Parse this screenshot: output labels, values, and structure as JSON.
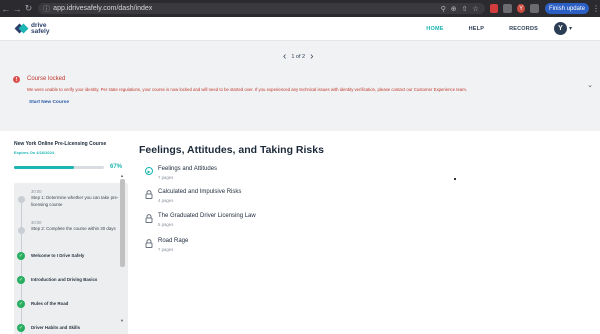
{
  "browser": {
    "url": "app.idrivesafely.com/dash/index",
    "profile_initial": "Y",
    "update_label": "Finish update"
  },
  "header": {
    "logo_line1": "drive",
    "logo_line2": "safely",
    "nav": {
      "home": "HOME",
      "help": "HELP",
      "records": "RECORDS"
    },
    "user_initial": "Y"
  },
  "pager": {
    "label": "1 of 2"
  },
  "alert": {
    "title": "Course locked",
    "message": "We were unable to verify your identity. Per state regulations, your course is now locked and will need to be started over. If you experienced any technical issues with identity verification, please contact our Customer Experience team.",
    "link": "Start New Course"
  },
  "sidebar": {
    "course_name": "New York Online Pre-Licensing Course",
    "expires": "Expires On 4/16/2024",
    "progress_value": 67,
    "progress_label": "67%",
    "steps": [
      {
        "time": "30:00",
        "text": "Step 1: Determine whether you can take pre-licensing course",
        "status": "pending"
      },
      {
        "time": "30:00",
        "text": "Step 2: Complete the course within 30 days",
        "status": "pending"
      },
      {
        "text": "Welcome to I Drive Safely",
        "status": "complete"
      },
      {
        "text": "Introduction and Driving Basics",
        "status": "complete"
      },
      {
        "text": "Rules of the Road",
        "status": "complete"
      },
      {
        "text": "Driver Habits and Skills",
        "status": "complete"
      }
    ]
  },
  "main": {
    "section_title": "Feelings, Attitudes, and Taking Risks",
    "modules": [
      {
        "title": "Feelings and Attitudes",
        "pages": "7 pages",
        "icon": "play-icon"
      },
      {
        "title": "Calculated and Impulsive Risks",
        "pages": "4 pages",
        "icon": "lock-icon"
      },
      {
        "title": "The Graduated Driver Licensing Law",
        "pages": "5 pages",
        "icon": "lock-icon"
      },
      {
        "title": "Road Rage",
        "pages": "7 pages",
        "icon": "lock-icon"
      }
    ]
  },
  "colors": {
    "accent": "#1bb5b3",
    "brand_navy": "#2c3e6b",
    "alert_red": "#c0392b",
    "success_green": "#27ae60"
  }
}
